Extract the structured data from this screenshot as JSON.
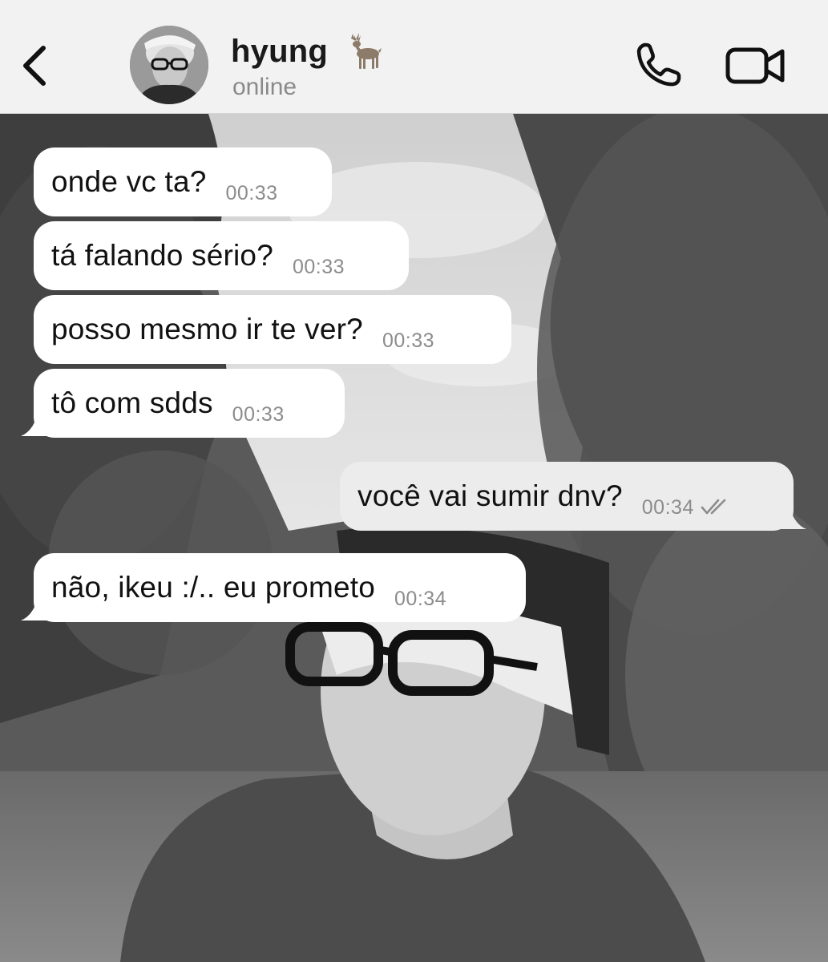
{
  "header": {
    "contact_name": "hyung",
    "contact_status": "online",
    "name_emoji": "deer"
  },
  "messages": [
    {
      "direction": "incoming",
      "text": "onde vc ta?",
      "time": "00:33"
    },
    {
      "direction": "incoming",
      "text": "tá falando sério?",
      "time": "00:33"
    },
    {
      "direction": "incoming",
      "text": "posso mesmo ir te ver?",
      "time": "00:33"
    },
    {
      "direction": "incoming",
      "text": "tô com sdds",
      "time": "00:33"
    },
    {
      "direction": "outgoing",
      "text": "você vai sumir dnv?",
      "time": "00:34",
      "status": "read"
    },
    {
      "direction": "incoming",
      "text": "não, ikeu :/.. eu prometo",
      "time": "00:34"
    }
  ],
  "icons": [
    "back-chevron-icon",
    "phone-icon",
    "video-camera-icon",
    "deer-icon",
    "double-check-icon"
  ],
  "colors": {
    "header_bg": "#f2f2f2",
    "incoming_bubble": "#ffffff",
    "outgoing_bubble": "#ececec",
    "timestamp": "#8c8c8c",
    "status_text": "#8a8a8a"
  }
}
